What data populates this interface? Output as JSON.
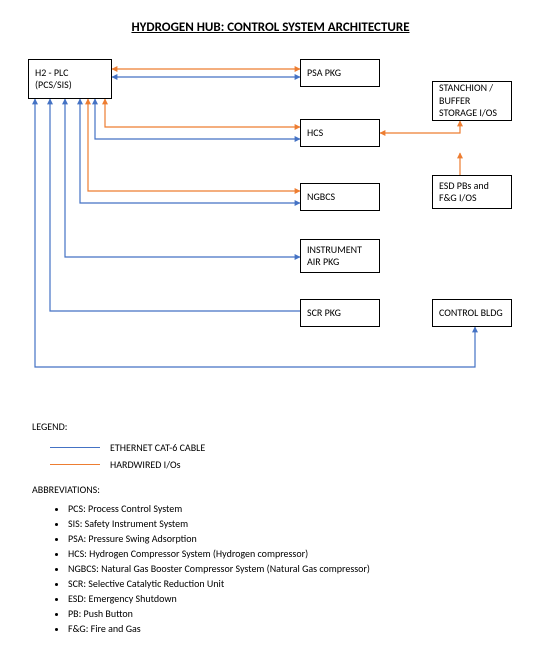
{
  "title": "HYDROGEN HUB: CONTROL SYSTEM ARCHITECTURE",
  "boxes": {
    "h2plc": {
      "line1": "H2 - PLC",
      "line2": "(PCS/SIS)"
    },
    "psa": "PSA PKG",
    "hcs": "HCS",
    "ngbcs": "NGBCS",
    "instr_air": "INSTRUMENT\nAIR PKG",
    "scr": "SCR PKG",
    "stanchion": "STANCHION /\nBUFFER\nSTORAGE I/OS",
    "esd": "ESD PBs and\nF&G I/OS",
    "ctrl_bldg": "CONTROL BLDG"
  },
  "legend": {
    "heading": "LEGEND:",
    "items": [
      {
        "color": "#4472C4",
        "label": "ETHERNET CAT-6 CABLE"
      },
      {
        "color": "#ED7D31",
        "label": "HARDWIRED I/Os"
      }
    ]
  },
  "abbreviations": {
    "heading": "ABBREVIATIONS:",
    "items": [
      "PCS: Process Control System",
      "SIS: Safety Instrument System",
      "PSA: Pressure Swing Adsorption",
      "HCS: Hydrogen Compressor System (Hydrogen compressor)",
      "NGBCS: Natural Gas Booster Compressor System (Natural Gas compressor)",
      "SCR: Selective Catalytic Reduction Unit",
      "ESD: Emergency Shutdown",
      "PB: Push Button",
      "F&G: Fire and Gas"
    ]
  },
  "colors": {
    "blue": "#4472C4",
    "orange": "#ED7D31"
  },
  "chart_data": {
    "type": "diagram",
    "title": "HYDROGEN HUB: CONTROL SYSTEM ARCHITECTURE",
    "nodes": [
      {
        "id": "h2plc",
        "label": "H2 - PLC (PCS/SIS)"
      },
      {
        "id": "psa",
        "label": "PSA PKG"
      },
      {
        "id": "hcs",
        "label": "HCS"
      },
      {
        "id": "ngbcs",
        "label": "NGBCS"
      },
      {
        "id": "instr_air",
        "label": "INSTRUMENT AIR PKG"
      },
      {
        "id": "scr",
        "label": "SCR PKG"
      },
      {
        "id": "stanchion",
        "label": "STANCHION / BUFFER STORAGE I/OS"
      },
      {
        "id": "esd",
        "label": "ESD PBs and F&G I/OS"
      },
      {
        "id": "ctrl_bldg",
        "label": "CONTROL BLDG"
      }
    ],
    "edges": [
      {
        "from": "h2plc",
        "to": "psa",
        "type": "ethernet",
        "bidirectional": true
      },
      {
        "from": "h2plc",
        "to": "psa",
        "type": "hardwired",
        "bidirectional": true
      },
      {
        "from": "h2plc",
        "to": "hcs",
        "type": "ethernet",
        "bidirectional": true
      },
      {
        "from": "h2plc",
        "to": "hcs",
        "type": "hardwired",
        "bidirectional": true
      },
      {
        "from": "h2plc",
        "to": "ngbcs",
        "type": "ethernet",
        "bidirectional": true
      },
      {
        "from": "h2plc",
        "to": "ngbcs",
        "type": "hardwired",
        "bidirectional": true
      },
      {
        "from": "h2plc",
        "to": "instr_air",
        "type": "ethernet",
        "bidirectional": true
      },
      {
        "from": "h2plc",
        "to": "scr",
        "type": "ethernet",
        "bidirectional": false
      },
      {
        "from": "h2plc",
        "to": "ctrl_bldg",
        "type": "ethernet",
        "bidirectional": true
      },
      {
        "from": "hcs",
        "to": "stanchion",
        "type": "hardwired",
        "bidirectional": true
      },
      {
        "from": "hcs",
        "to": "esd",
        "type": "hardwired",
        "bidirectional": true
      }
    ],
    "legend": [
      {
        "type": "ethernet",
        "label": "ETHERNET CAT-6 CABLE",
        "color": "#4472C4"
      },
      {
        "type": "hardwired",
        "label": "HARDWIRED I/Os",
        "color": "#ED7D31"
      }
    ]
  }
}
